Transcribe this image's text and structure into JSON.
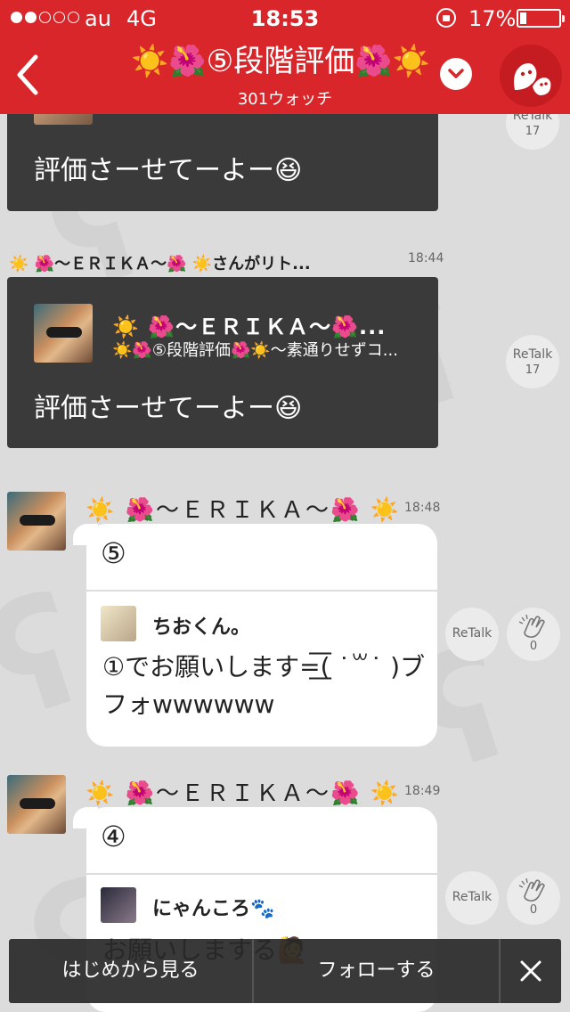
{
  "status_bar": {
    "carrier": "au",
    "network": "4G",
    "time": "18:53",
    "battery": "17%",
    "battery_level": 0.17
  },
  "header": {
    "title": "☀️🌺⑤段階評価🌺☀️",
    "subtitle": "301ウォッチ",
    "accent_color": "#d8262a"
  },
  "posts": [
    {
      "type": "retalk-card",
      "text": "評価さーせてーよー😆",
      "retalk_label": "ReTalk",
      "retalk_count": "17"
    },
    {
      "type": "retalk-card",
      "retalked_by": "☀️ 🌺〜ＥＲＩＫＡ〜🌺 ☀️さんがリト...",
      "timestamp": "18:44",
      "quoted_user": "☀️ 🌺〜ＥＲＩＫＡ〜🌺...",
      "quoted_room": "☀️🌺⑤段階評価🌺☀️〜素通りせずコ...",
      "text": "評価さーせてーよー😆",
      "retalk_label": "ReTalk",
      "retalk_count": "17"
    },
    {
      "type": "message",
      "author": "☀️ 🌺〜ＥＲＩＫＡ〜🌺 ☀️",
      "timestamp": "18:48",
      "body": "⑤",
      "quoted_user": "ちおくん。",
      "quoted_text": "①でお願いします=͟͟͞͞( ˙꒳˙ )ブフォwwwwww",
      "retalk_label": "ReTalk",
      "clap_count": "0"
    },
    {
      "type": "message",
      "author": "☀️ 🌺〜ＥＲＩＫＡ〜🌺 ☀️",
      "timestamp": "18:49",
      "body": "④",
      "quoted_user": "にゃんころ🐾",
      "quoted_text": "お願いしまする🙋",
      "retalk_label": "ReTalk",
      "clap_count": "0"
    }
  ],
  "bottom_bar": {
    "from_start": "はじめから見る",
    "follow": "フォローする",
    "close_icon": "close-icon"
  }
}
